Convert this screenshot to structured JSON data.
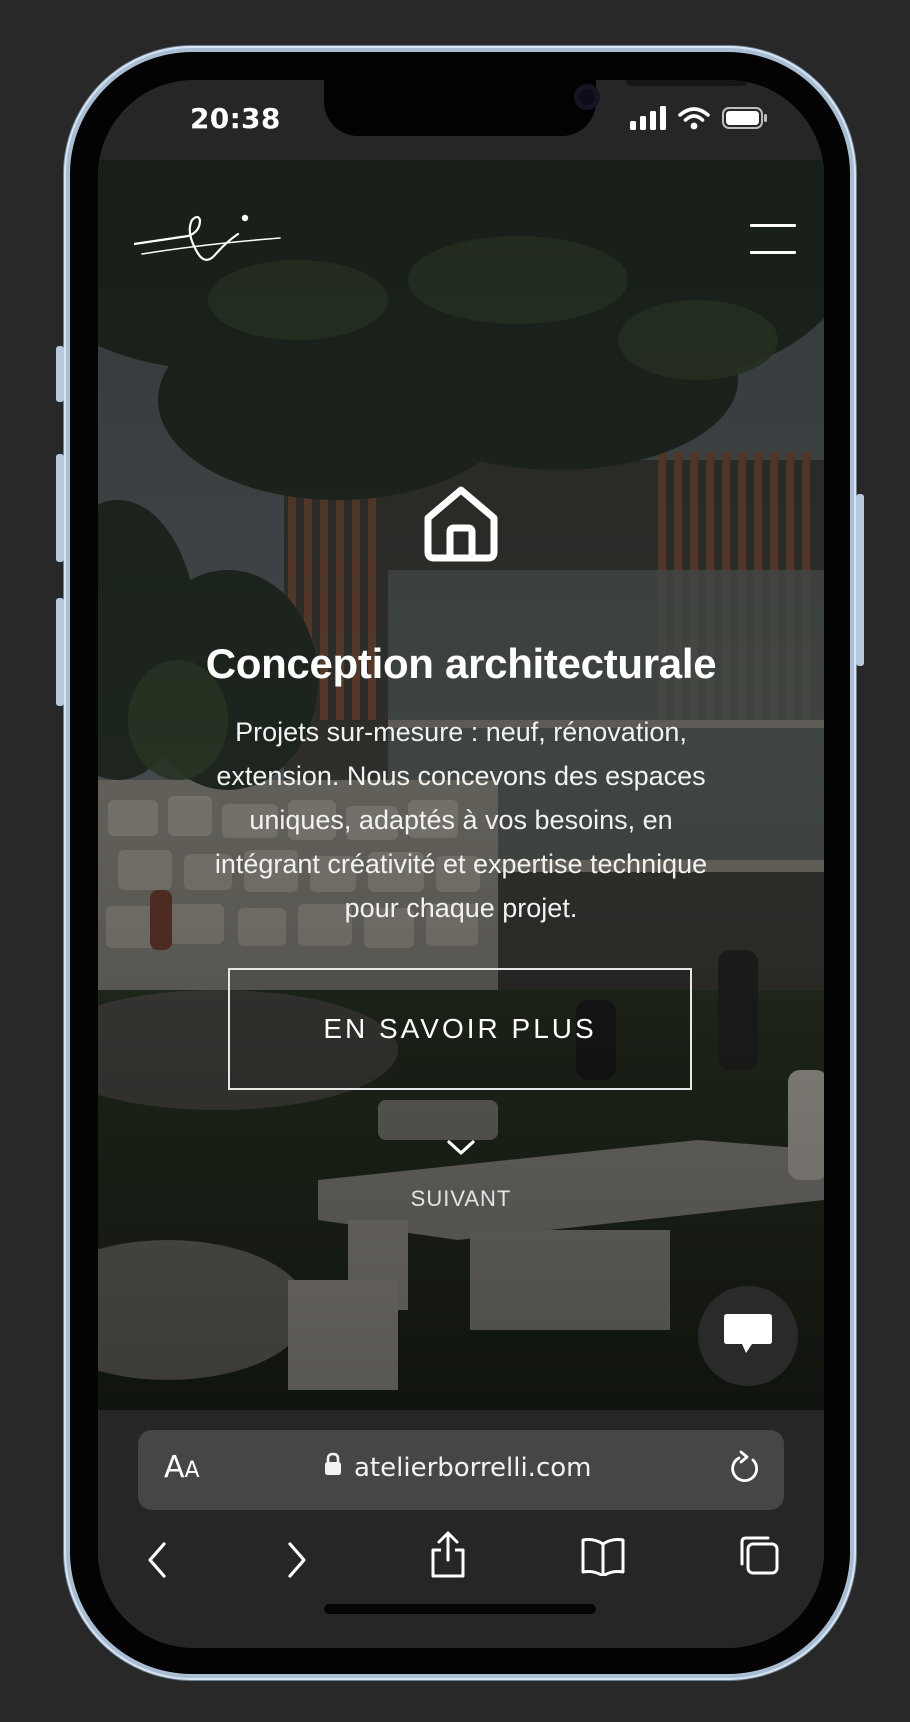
{
  "status_bar": {
    "time": "20:38",
    "icons": [
      "signal-icon",
      "wifi-icon",
      "battery-icon"
    ]
  },
  "header": {
    "logo_icon": "signature-logo-icon",
    "menu_icon": "hamburger-menu-icon"
  },
  "hero": {
    "icon": "house-icon",
    "title": "Conception architecturale",
    "description_lines": [
      "Projets sur-mesure : neuf, rénovation,",
      "extension. Nous concevons des espaces",
      "uniques, adaptés à vos besoins, en",
      "intégrant créativité et expertise technique",
      "pour chaque projet."
    ],
    "cta_label": "EN SAVOIR PLUS",
    "next_icon": "chevron-down-icon",
    "next_label": "SUIVANT"
  },
  "chat": {
    "icon": "chat-bubble-icon"
  },
  "browser": {
    "text_size_label_big": "A",
    "text_size_label_small": "A",
    "url": "atelierborrelli.com",
    "lock_icon": "lock-icon",
    "reload_icon": "reload-icon",
    "toolbar_icons": [
      "back-icon",
      "forward-icon",
      "share-icon",
      "bookmarks-icon",
      "tabs-icon"
    ]
  },
  "colors": {
    "background": "#282828",
    "frame": "#a9bdd3",
    "browser_chrome": "#262626",
    "url_bar": "#464646",
    "text": "#ffffff"
  }
}
